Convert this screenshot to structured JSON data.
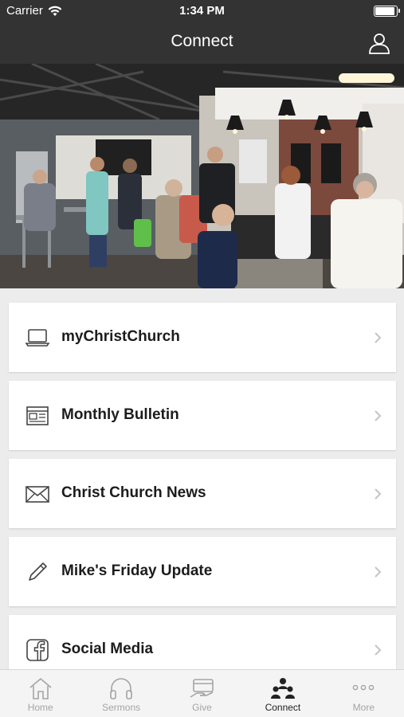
{
  "status_bar": {
    "carrier": "Carrier",
    "time": "1:34 PM"
  },
  "nav": {
    "title": "Connect",
    "profile_icon": "user-icon"
  },
  "hero": {
    "description_icon": "photo"
  },
  "items": [
    {
      "label": "myChristChurch",
      "icon": "laptop-icon"
    },
    {
      "label": "Monthly Bulletin",
      "icon": "newspaper-icon"
    },
    {
      "label": "Christ Church News",
      "icon": "envelope-icon"
    },
    {
      "label": "Mike's Friday Update",
      "icon": "pencil-icon"
    },
    {
      "label": "Social Media",
      "icon": "facebook-icon"
    }
  ],
  "tabs": [
    {
      "label": "Home",
      "icon": "home-icon",
      "active": false
    },
    {
      "label": "Sermons",
      "icon": "headphones-icon",
      "active": false
    },
    {
      "label": "Give",
      "icon": "give-icon",
      "active": false
    },
    {
      "label": "Connect",
      "icon": "people-icon",
      "active": true
    },
    {
      "label": "More",
      "icon": "more-icon",
      "active": false
    }
  ],
  "colors": {
    "header": "#333333",
    "background": "#ececec",
    "card": "#ffffff",
    "tab_inactive": "#a4a4a4",
    "tab_active": "#222222"
  }
}
